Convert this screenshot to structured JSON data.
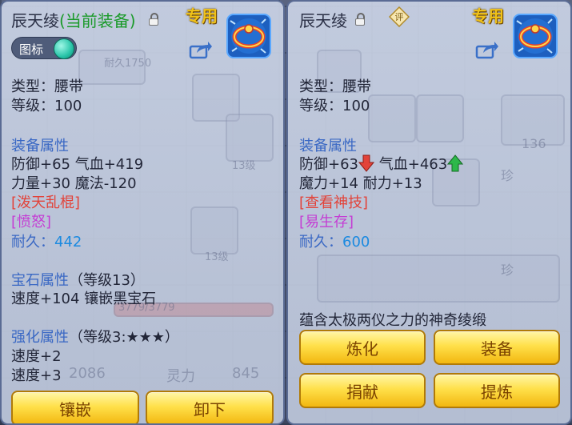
{
  "left": {
    "title": "辰天绫",
    "equipped_tag": "(当前装备)",
    "exclusive": "专用",
    "toggle_label": "图标",
    "type": "类型：腰带",
    "level": "等级：100",
    "equip_attr_header": "装备属性",
    "attr_line1": "防御+65 气血+419",
    "attr_line2": "力量+30 魔法-120",
    "special_skill": "[泼天乱棍]",
    "special_effect": "[愤怒]",
    "durability_label": "耐久：",
    "durability_value": "442",
    "gem_header": "宝石属性",
    "gem_level": "（等级13）",
    "gem_line": "速度+104 镶嵌黑宝石",
    "enhance_header": "强化属性",
    "enhance_level": "（等级3:★★★）",
    "enhance_line1": "速度+2",
    "enhance_line2": "速度+3",
    "buttons": [
      "镶嵌",
      "卸下"
    ]
  },
  "right": {
    "title": "辰天绫",
    "rate_badge": "评",
    "exclusive": "专用",
    "type": "类型：腰带",
    "level": "等级：100",
    "equip_attr_header": "装备属性",
    "attr_def": "防御+63",
    "attr_hp": "气血+463",
    "attr_line2": "魔力+14 耐力+13",
    "special_skill": "[查看神技]",
    "special_effect": "[易生存]",
    "durability_label": "耐久：",
    "durability_value": "600",
    "description": "蕴含太极两仪之力的神奇绫缎",
    "buttons": [
      "炼化",
      "装备",
      "捐献",
      "提炼"
    ]
  },
  "background": {
    "ghost_labels": [
      "耐久1750",
      "13级",
      "13级",
      "13级",
      "13级",
      "3779/3779",
      "2086",
      "灵力",
      "845",
      "136",
      "珍",
      "珍"
    ]
  },
  "colors": {
    "stat_down": "#e2433a",
    "stat_up": "#2db84a",
    "button_gold": "#ffe04a",
    "header_blue": "#3a68c4"
  },
  "icons": [
    "lock-icon",
    "belt-item-icon",
    "share-icon",
    "down-arrow-icon",
    "up-arrow-icon",
    "rate-badge-icon"
  ]
}
